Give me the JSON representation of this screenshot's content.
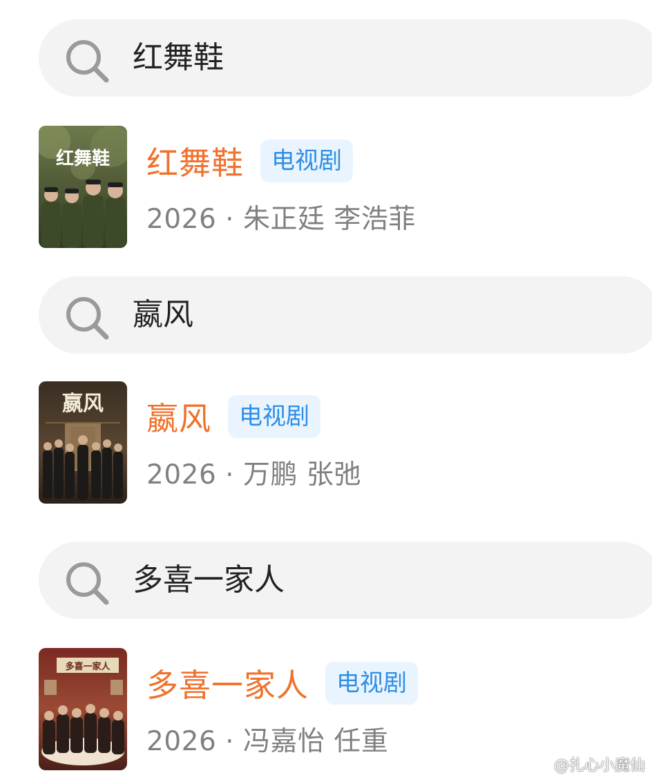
{
  "groups": [
    {
      "search": {
        "query": "红舞鞋",
        "icon": "search-icon"
      },
      "result": {
        "title": "红舞鞋",
        "type_badge": "电视剧",
        "meta": "2026 · 朱正廷 李浩菲",
        "poster_text": "红舞鞋"
      }
    },
    {
      "search": {
        "query": "嬴风",
        "icon": "search-icon"
      },
      "result": {
        "title": "嬴风",
        "type_badge": "电视剧",
        "meta": "2026 · 万鹏 张弛",
        "poster_text": "嬴风"
      }
    },
    {
      "search": {
        "query": "多喜一家人",
        "icon": "search-icon"
      },
      "result": {
        "title": "多喜一家人",
        "type_badge": "电视剧",
        "meta": "2026 · 冯嘉怡 任重",
        "poster_text": "多喜一家人"
      }
    }
  ],
  "watermark": {
    "text": "@扎心小魔仙",
    "icon": "weibo-icon"
  },
  "colors": {
    "title": "#f0712c",
    "badge_bg": "#e9f4fe",
    "badge_text": "#2e8ee6",
    "meta": "#808080",
    "search_bg": "#f3f3f3"
  }
}
